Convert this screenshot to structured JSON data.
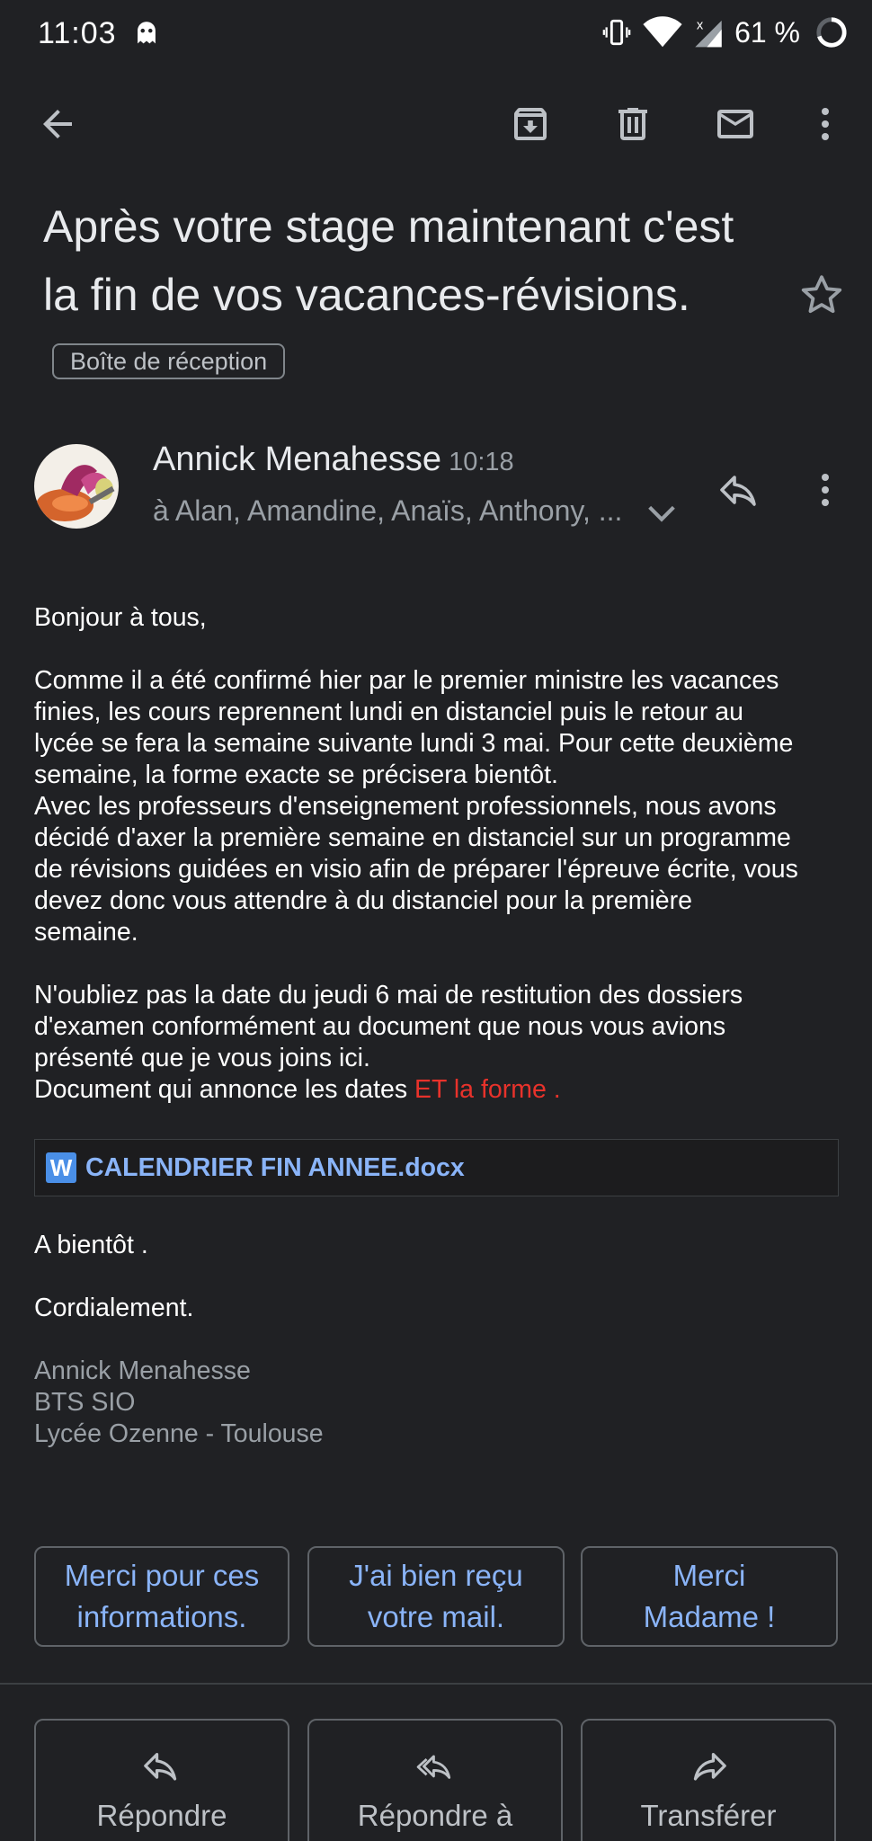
{
  "status_bar": {
    "time": "11:03",
    "battery": "61 %",
    "icons": [
      "ghost-icon",
      "vibrate-icon",
      "wifi-icon",
      "signal-icon",
      "battery-ring-icon"
    ]
  },
  "toolbar": {
    "icons": [
      "back-arrow-icon",
      "archive-icon",
      "delete-icon",
      "mark-unread-icon",
      "more-vert-icon"
    ]
  },
  "email": {
    "subject": "Après votre stage maintenant c'est la fin de vos vacances-révisions.",
    "label": "Boîte de réception",
    "sender": "Annick Menahesse",
    "time": "10:18",
    "recipients": "à Alan, Amandine, Anaïs, Anthony, ...",
    "greeting": "Bonjour à tous,",
    "para1_lines": [
      "Comme il a été confirmé hier par le premier ministre les vacances",
      "finies, les cours reprennent  lundi en distanciel puis le retour au",
      "lycée se fera la semaine suivante lundi 3 mai. Pour cette deuxième",
      "semaine, la forme exacte se précisera bientôt.",
      "Avec les professeurs d'enseignement professionnels, nous avons",
      "décidé d'axer la première semaine en distanciel sur un programme",
      "de révisions guidées en visio afin de préparer l'épreuve écrite, vous",
      "devez donc vous attendre à du distanciel pour la première",
      "semaine."
    ],
    "para2_lines": [
      "N'oubliez pas la date du jeudi 6 mai de restitution des dossiers",
      "d'examen conformément au document que nous vous avions",
      "présenté que je vous joins ici."
    ],
    "doc_line_prefix": "Document qui annonce les dates ",
    "doc_line_highlight": "ET la forme .",
    "attachment": {
      "icon_letter": "W",
      "name": "CALENDRIER FIN ANNEE.docx"
    },
    "closing1": "A bientôt .",
    "closing2": "Cordialement.",
    "signature": [
      "Annick Menahesse",
      "BTS SIO",
      "Lycée Ozenne - Toulouse"
    ]
  },
  "smart_replies": [
    [
      "Merci pour ces",
      "informations."
    ],
    [
      "J'ai bien reçu",
      "votre mail."
    ],
    [
      "Merci",
      "Madame !"
    ]
  ],
  "actions": {
    "reply": "Répondre",
    "reply_all": "Répondre à",
    "forward": "Transférer"
  },
  "colors": {
    "background": "#202124",
    "link": "#8ab4f8",
    "highlight_red": "#e8322b"
  }
}
